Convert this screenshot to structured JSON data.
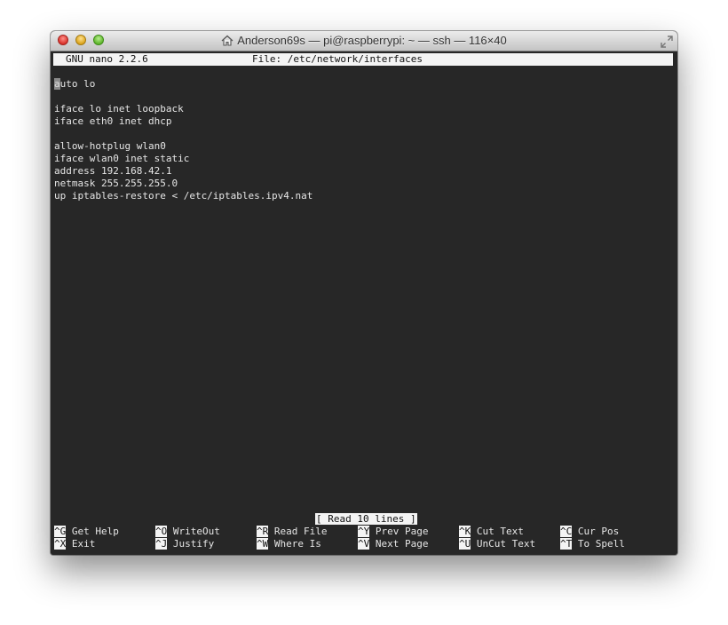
{
  "window": {
    "title": "Anderson69s — pi@raspberrypi: ~ — ssh — 116×40",
    "home_icon": "home-icon",
    "fullscreen_icon": "fullscreen-arrows-icon"
  },
  "nano": {
    "version": "GNU nano 2.2.6",
    "file": "File: /etc/network/interfaces",
    "status": "[ Read 10 lines ]",
    "lines": [
      "",
      "auto lo",
      "",
      "iface lo inet loopback",
      "iface eth0 inet dhcp",
      "",
      "allow-hotplug wlan0",
      "iface wlan0 inet static",
      "address 192.168.42.1",
      "netmask 255.255.255.0",
      "up iptables-restore < /etc/iptables.ipv4.nat"
    ],
    "cursor_line": {
      "char": "a",
      "rest": "uto lo"
    },
    "shortcuts_row1": [
      {
        "key": "^G",
        "label": "Get Help"
      },
      {
        "key": "^O",
        "label": "WriteOut"
      },
      {
        "key": "^R",
        "label": "Read File"
      },
      {
        "key": "^Y",
        "label": "Prev Page"
      },
      {
        "key": "^K",
        "label": "Cut Text"
      },
      {
        "key": "^C",
        "label": "Cur Pos"
      }
    ],
    "shortcuts_row2": [
      {
        "key": "^X",
        "label": "Exit"
      },
      {
        "key": "^J",
        "label": "Justify"
      },
      {
        "key": "^W",
        "label": "Where Is"
      },
      {
        "key": "^V",
        "label": "Next Page"
      },
      {
        "key": "^U",
        "label": "UnCut Text"
      },
      {
        "key": "^T",
        "label": "To Spell"
      }
    ]
  },
  "colors": {
    "terminal_bg": "#272727",
    "terminal_fg": "#e6e6e6",
    "inverse_bg": "#f4f4f4"
  }
}
